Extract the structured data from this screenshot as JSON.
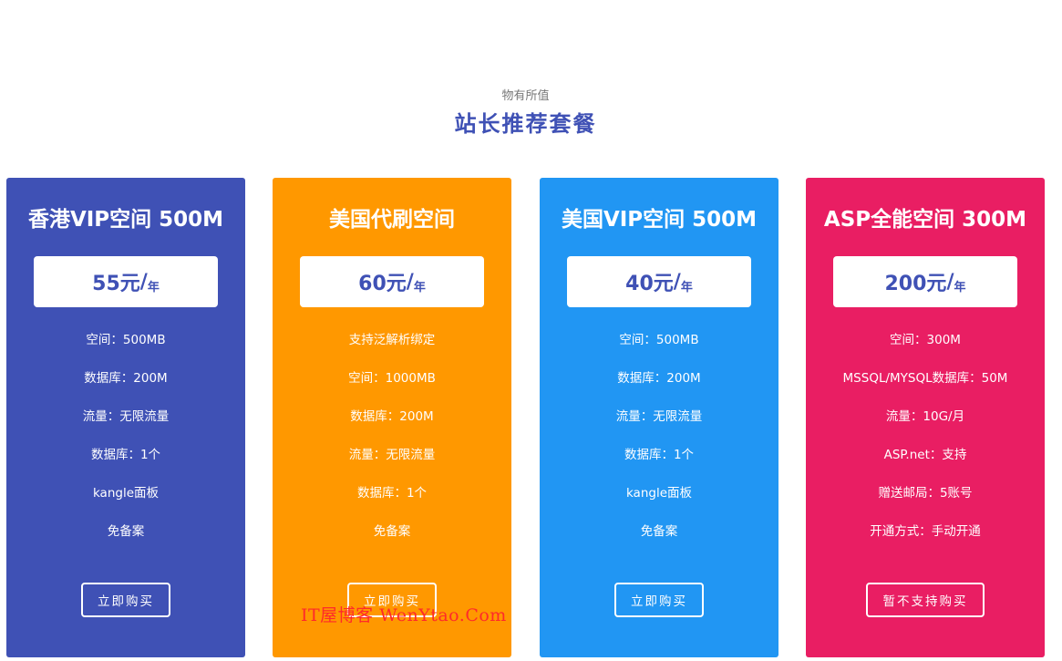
{
  "header": {
    "subtitle": "物有所值",
    "title": "站长推荐套餐"
  },
  "colors": {
    "accent": "#3f51b5",
    "card_1": "#3f51b5",
    "card_2": "#ff9800",
    "card_3": "#2196f3",
    "card_4": "#e91e63"
  },
  "cards": [
    {
      "title": "香港VIP空间 500M",
      "price": "55元",
      "slash": "/",
      "unit": "年",
      "features": [
        "空间：500MB",
        "数据库：200M",
        "流量：无限流量",
        "数据库：1个",
        "kangle面板",
        "免备案"
      ],
      "button": "立即购买"
    },
    {
      "title": "美国代刷空间",
      "price": "60元",
      "slash": "/",
      "unit": "年",
      "features": [
        "支持泛解析绑定",
        "空间：1000MB",
        "数据库：200M",
        "流量：无限流量",
        "数据库：1个",
        "免备案"
      ],
      "button": "立即购买"
    },
    {
      "title": "美国VIP空间 500M",
      "price": "40元",
      "slash": "/",
      "unit": "年",
      "features": [
        "空间：500MB",
        "数据库：200M",
        "流量：无限流量",
        "数据库：1个",
        "kangle面板",
        "免备案"
      ],
      "button": "立即购买"
    },
    {
      "title": "ASP全能空间 300M",
      "price": "200元",
      "slash": "/",
      "unit": "年",
      "features": [
        "空间：300M",
        "MSSQL/MYSQL数据库：50M",
        "流量：10G/月",
        "ASP.net：支持",
        "赠送邮局：5账号",
        "开通方式：手动开通"
      ],
      "button": "暂不支持购买"
    }
  ],
  "watermark": "IT屋博客 WenYtao.Com"
}
